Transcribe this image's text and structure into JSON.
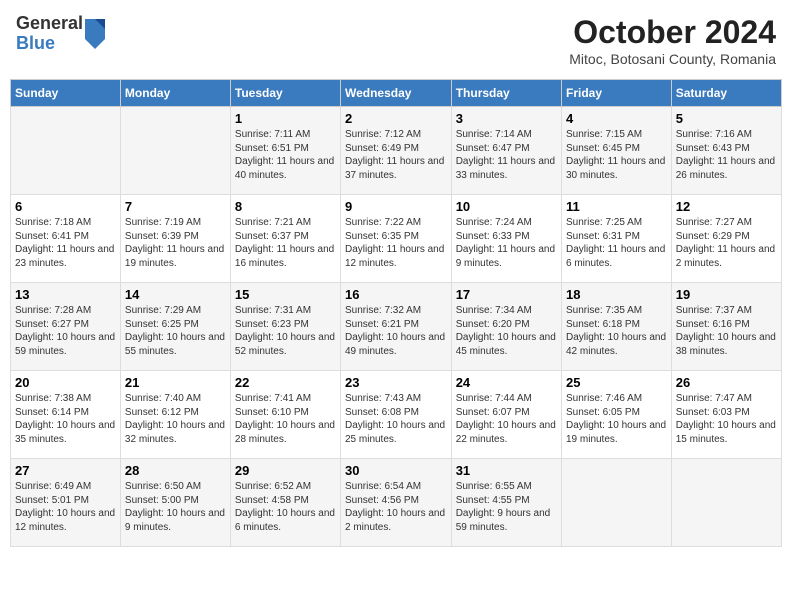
{
  "header": {
    "logo": {
      "general": "General",
      "blue": "Blue"
    },
    "title": "October 2024",
    "subtitle": "Mitoc, Botosani County, Romania"
  },
  "days_of_week": [
    "Sunday",
    "Monday",
    "Tuesday",
    "Wednesday",
    "Thursday",
    "Friday",
    "Saturday"
  ],
  "weeks": [
    [
      {
        "day": "",
        "info": ""
      },
      {
        "day": "",
        "info": ""
      },
      {
        "day": "1",
        "info": "Sunrise: 7:11 AM\nSunset: 6:51 PM\nDaylight: 11 hours and 40 minutes."
      },
      {
        "day": "2",
        "info": "Sunrise: 7:12 AM\nSunset: 6:49 PM\nDaylight: 11 hours and 37 minutes."
      },
      {
        "day": "3",
        "info": "Sunrise: 7:14 AM\nSunset: 6:47 PM\nDaylight: 11 hours and 33 minutes."
      },
      {
        "day": "4",
        "info": "Sunrise: 7:15 AM\nSunset: 6:45 PM\nDaylight: 11 hours and 30 minutes."
      },
      {
        "day": "5",
        "info": "Sunrise: 7:16 AM\nSunset: 6:43 PM\nDaylight: 11 hours and 26 minutes."
      }
    ],
    [
      {
        "day": "6",
        "info": "Sunrise: 7:18 AM\nSunset: 6:41 PM\nDaylight: 11 hours and 23 minutes."
      },
      {
        "day": "7",
        "info": "Sunrise: 7:19 AM\nSunset: 6:39 PM\nDaylight: 11 hours and 19 minutes."
      },
      {
        "day": "8",
        "info": "Sunrise: 7:21 AM\nSunset: 6:37 PM\nDaylight: 11 hours and 16 minutes."
      },
      {
        "day": "9",
        "info": "Sunrise: 7:22 AM\nSunset: 6:35 PM\nDaylight: 11 hours and 12 minutes."
      },
      {
        "day": "10",
        "info": "Sunrise: 7:24 AM\nSunset: 6:33 PM\nDaylight: 11 hours and 9 minutes."
      },
      {
        "day": "11",
        "info": "Sunrise: 7:25 AM\nSunset: 6:31 PM\nDaylight: 11 hours and 6 minutes."
      },
      {
        "day": "12",
        "info": "Sunrise: 7:27 AM\nSunset: 6:29 PM\nDaylight: 11 hours and 2 minutes."
      }
    ],
    [
      {
        "day": "13",
        "info": "Sunrise: 7:28 AM\nSunset: 6:27 PM\nDaylight: 10 hours and 59 minutes."
      },
      {
        "day": "14",
        "info": "Sunrise: 7:29 AM\nSunset: 6:25 PM\nDaylight: 10 hours and 55 minutes."
      },
      {
        "day": "15",
        "info": "Sunrise: 7:31 AM\nSunset: 6:23 PM\nDaylight: 10 hours and 52 minutes."
      },
      {
        "day": "16",
        "info": "Sunrise: 7:32 AM\nSunset: 6:21 PM\nDaylight: 10 hours and 49 minutes."
      },
      {
        "day": "17",
        "info": "Sunrise: 7:34 AM\nSunset: 6:20 PM\nDaylight: 10 hours and 45 minutes."
      },
      {
        "day": "18",
        "info": "Sunrise: 7:35 AM\nSunset: 6:18 PM\nDaylight: 10 hours and 42 minutes."
      },
      {
        "day": "19",
        "info": "Sunrise: 7:37 AM\nSunset: 6:16 PM\nDaylight: 10 hours and 38 minutes."
      }
    ],
    [
      {
        "day": "20",
        "info": "Sunrise: 7:38 AM\nSunset: 6:14 PM\nDaylight: 10 hours and 35 minutes."
      },
      {
        "day": "21",
        "info": "Sunrise: 7:40 AM\nSunset: 6:12 PM\nDaylight: 10 hours and 32 minutes."
      },
      {
        "day": "22",
        "info": "Sunrise: 7:41 AM\nSunset: 6:10 PM\nDaylight: 10 hours and 28 minutes."
      },
      {
        "day": "23",
        "info": "Sunrise: 7:43 AM\nSunset: 6:08 PM\nDaylight: 10 hours and 25 minutes."
      },
      {
        "day": "24",
        "info": "Sunrise: 7:44 AM\nSunset: 6:07 PM\nDaylight: 10 hours and 22 minutes."
      },
      {
        "day": "25",
        "info": "Sunrise: 7:46 AM\nSunset: 6:05 PM\nDaylight: 10 hours and 19 minutes."
      },
      {
        "day": "26",
        "info": "Sunrise: 7:47 AM\nSunset: 6:03 PM\nDaylight: 10 hours and 15 minutes."
      }
    ],
    [
      {
        "day": "27",
        "info": "Sunrise: 6:49 AM\nSunset: 5:01 PM\nDaylight: 10 hours and 12 minutes."
      },
      {
        "day": "28",
        "info": "Sunrise: 6:50 AM\nSunset: 5:00 PM\nDaylight: 10 hours and 9 minutes."
      },
      {
        "day": "29",
        "info": "Sunrise: 6:52 AM\nSunset: 4:58 PM\nDaylight: 10 hours and 6 minutes."
      },
      {
        "day": "30",
        "info": "Sunrise: 6:54 AM\nSunset: 4:56 PM\nDaylight: 10 hours and 2 minutes."
      },
      {
        "day": "31",
        "info": "Sunrise: 6:55 AM\nSunset: 4:55 PM\nDaylight: 9 hours and 59 minutes."
      },
      {
        "day": "",
        "info": ""
      },
      {
        "day": "",
        "info": ""
      }
    ]
  ]
}
